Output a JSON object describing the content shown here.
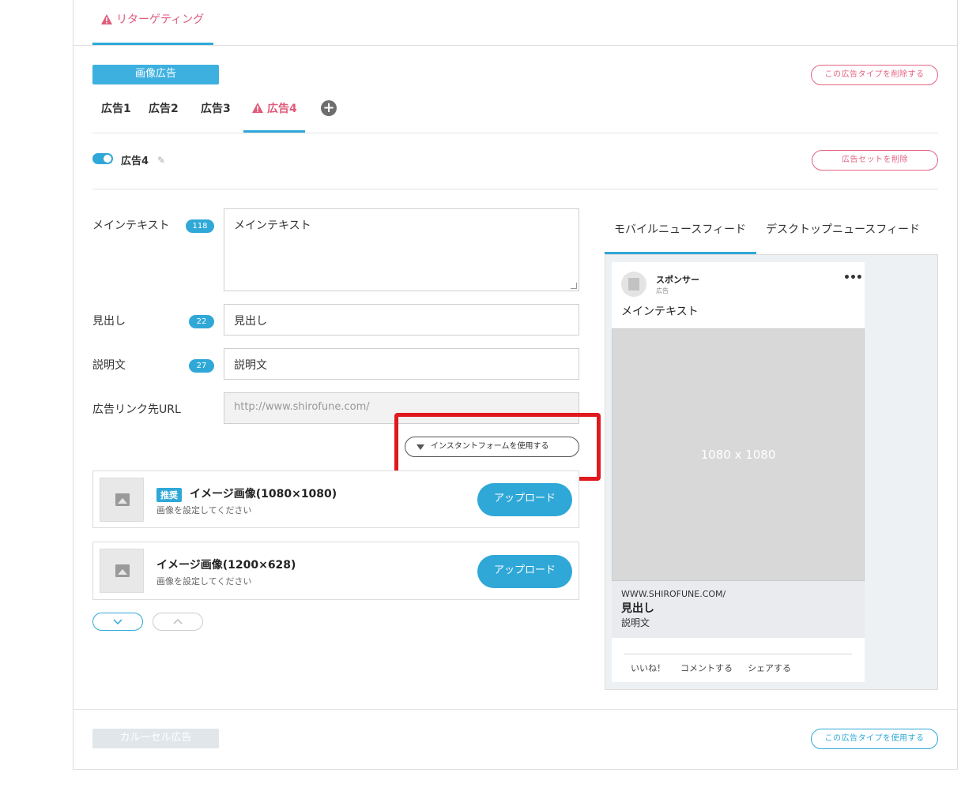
{
  "retargeting_tab": {
    "label": "リターゲティング"
  },
  "image_ad": {
    "type_label": "画像広告",
    "delete_type_label": "この広告タイプを削除する",
    "tabs": [
      "広告1",
      "広告2",
      "広告3",
      "広告4"
    ],
    "active_tab": "広告4",
    "ad_name": "広告4",
    "delete_set_label": "広告セットを削除"
  },
  "form": {
    "main_text": {
      "label": "メインテキスト",
      "count": "118",
      "value": "メインテキスト"
    },
    "headline": {
      "label": "見出し",
      "count": "22",
      "value": "見出し"
    },
    "description": {
      "label": "説明文",
      "count": "27",
      "value": "説明文"
    },
    "url": {
      "label": "広告リンク先URL",
      "placeholder": "http://www.shirofune.com/"
    },
    "instant_form_label": "インスタントフォームを使用する"
  },
  "uploads": [
    {
      "badge": "推奨",
      "title": "イメージ画像(1080×1080)",
      "sub": "画像を設定してください",
      "button": "アップロード"
    },
    {
      "badge": "",
      "title": "イメージ画像(1200×628)",
      "sub": "画像を設定してください",
      "button": "アップロード"
    }
  ],
  "preview": {
    "tabs": [
      "モバイルニュースフィード",
      "デスクトップニュースフィード"
    ],
    "sponsor": "スポンサー",
    "sponsor_sub": "広告",
    "main_text": "メインテキスト",
    "image_dim": "1080 x 1080",
    "url": "WWW.SHIROFUNE.COM/",
    "headline": "見出し",
    "description": "説明文",
    "actions": [
      "いいね！",
      "コメントする",
      "シェアする"
    ]
  },
  "carousel": {
    "type_label": "カルーセル広告",
    "use_type_label": "この広告タイプを使用する"
  },
  "colors": {
    "accent": "#2fa8d8",
    "warning": "#e05a7a",
    "highlight": "#e0191f"
  }
}
